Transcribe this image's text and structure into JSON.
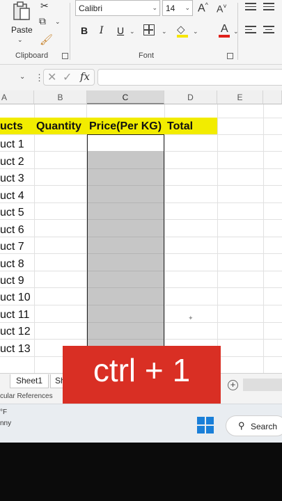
{
  "ribbon": {
    "clipboard": {
      "paste_label": "Paste",
      "group_label": "Clipboard",
      "icons": [
        "paste-icon",
        "cut-icon",
        "copy-icon",
        "format-painter-icon"
      ]
    },
    "font": {
      "font_name": "Calibri",
      "font_size": "14",
      "group_label": "Font",
      "bold": "B",
      "italic": "I",
      "underline": "U",
      "grow_font": "A^",
      "shrink_font": "A˅",
      "fill_color": "#f6e600",
      "font_color": "#e0211b"
    }
  },
  "formula_bar": {
    "fx": "fx",
    "value": ""
  },
  "columns": [
    "A",
    "B",
    "C",
    "D",
    "E"
  ],
  "table": {
    "header_band_color": "#f2ec00",
    "headers": [
      "ucts",
      "Quantity",
      "Price(Per KG)",
      "Total"
    ],
    "rows": [
      "uct 1",
      "uct 2",
      "uct 3",
      "uct 4",
      "uct 5",
      "uct 6",
      "uct 7",
      "uct 8",
      "uct 9",
      "uct 10",
      "uct 11",
      "uct 12",
      "uct 13"
    ]
  },
  "sheets": {
    "tab1": "Sheet1",
    "tab2": "Sh"
  },
  "status": {
    "text": "cular References"
  },
  "taskbar": {
    "weather_temp": "°F",
    "weather_cond": "nny",
    "search_label": "Search"
  },
  "overlay": {
    "text": "ctrl + 1",
    "color": "#d92f24"
  }
}
